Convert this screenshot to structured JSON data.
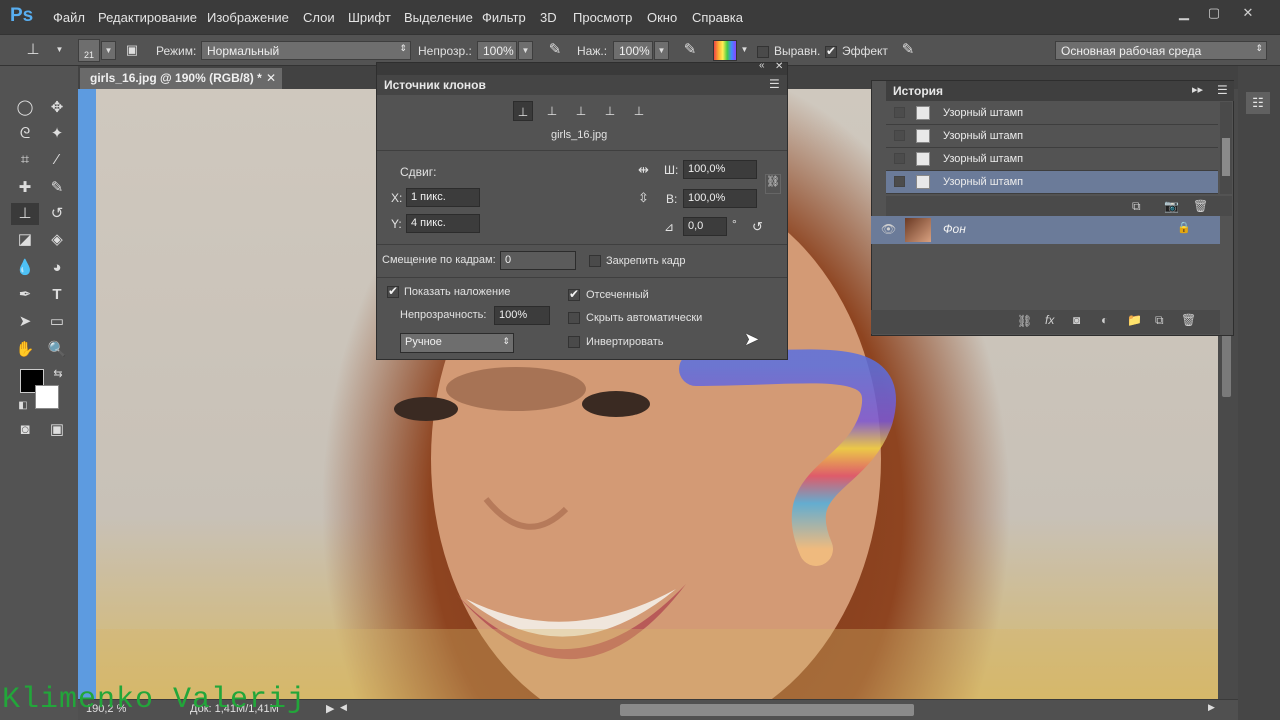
{
  "app": {
    "logo": "Ps"
  },
  "menu": [
    "Файл",
    "Редактирование",
    "Изображение",
    "Слои",
    "Шрифт",
    "Выделение",
    "Фильтр",
    "3D",
    "Просмотр",
    "Окно",
    "Справка"
  ],
  "options": {
    "brush_size": "21",
    "mode_label": "Режим:",
    "mode_value": "Нормальный",
    "opacity_label": "Непрозр.:",
    "opacity_value": "100%",
    "pressure_label": "Наж.:",
    "pressure_value": "100%",
    "align_label": "Выравн.",
    "effect_label": "Эффект",
    "workspace": "Основная рабочая среда"
  },
  "document": {
    "tab_title": "girls_16.jpg @ 190% (RGB/8) *"
  },
  "clone_source": {
    "title": "Источник клонов",
    "file": "girls_16.jpg",
    "offset_label": "Сдвиг:",
    "x_label": "X:",
    "x_value": "1 пикс.",
    "y_label": "Y:",
    "y_value": "4 пикс.",
    "w_label": "Ш:",
    "w_value": "100,0%",
    "h_label": "В:",
    "h_value": "100,0%",
    "angle_value": "0,0",
    "angle_unit": "°",
    "frame_offset_label": "Смещение по кадрам:",
    "frame_offset_value": "0",
    "lock_frame_label": "Закрепить кадр",
    "show_overlay_label": "Показать наложение",
    "overlay_opacity_label": "Непрозрачность:",
    "overlay_opacity_value": "100%",
    "overlay_mode": "Ручное",
    "clipped_label": "Отсеченный",
    "auto_hide_label": "Скрыть автоматически",
    "invert_label": "Инвертировать"
  },
  "history": {
    "title": "История",
    "items": [
      "Узорный штамп",
      "Узорный штамп",
      "Узорный штамп",
      "Узорный штамп"
    ]
  },
  "layers": {
    "layer_name": "Фон"
  },
  "status": {
    "zoom": "190,2 %",
    "doc_info": "Док: 1,41М/1,41М"
  },
  "watermark": "Klimenko Valerij",
  "colors": {
    "accent_blue": "#5d9be0",
    "selected_row": "#6b7b99",
    "ps_blue": "#58aef0"
  }
}
